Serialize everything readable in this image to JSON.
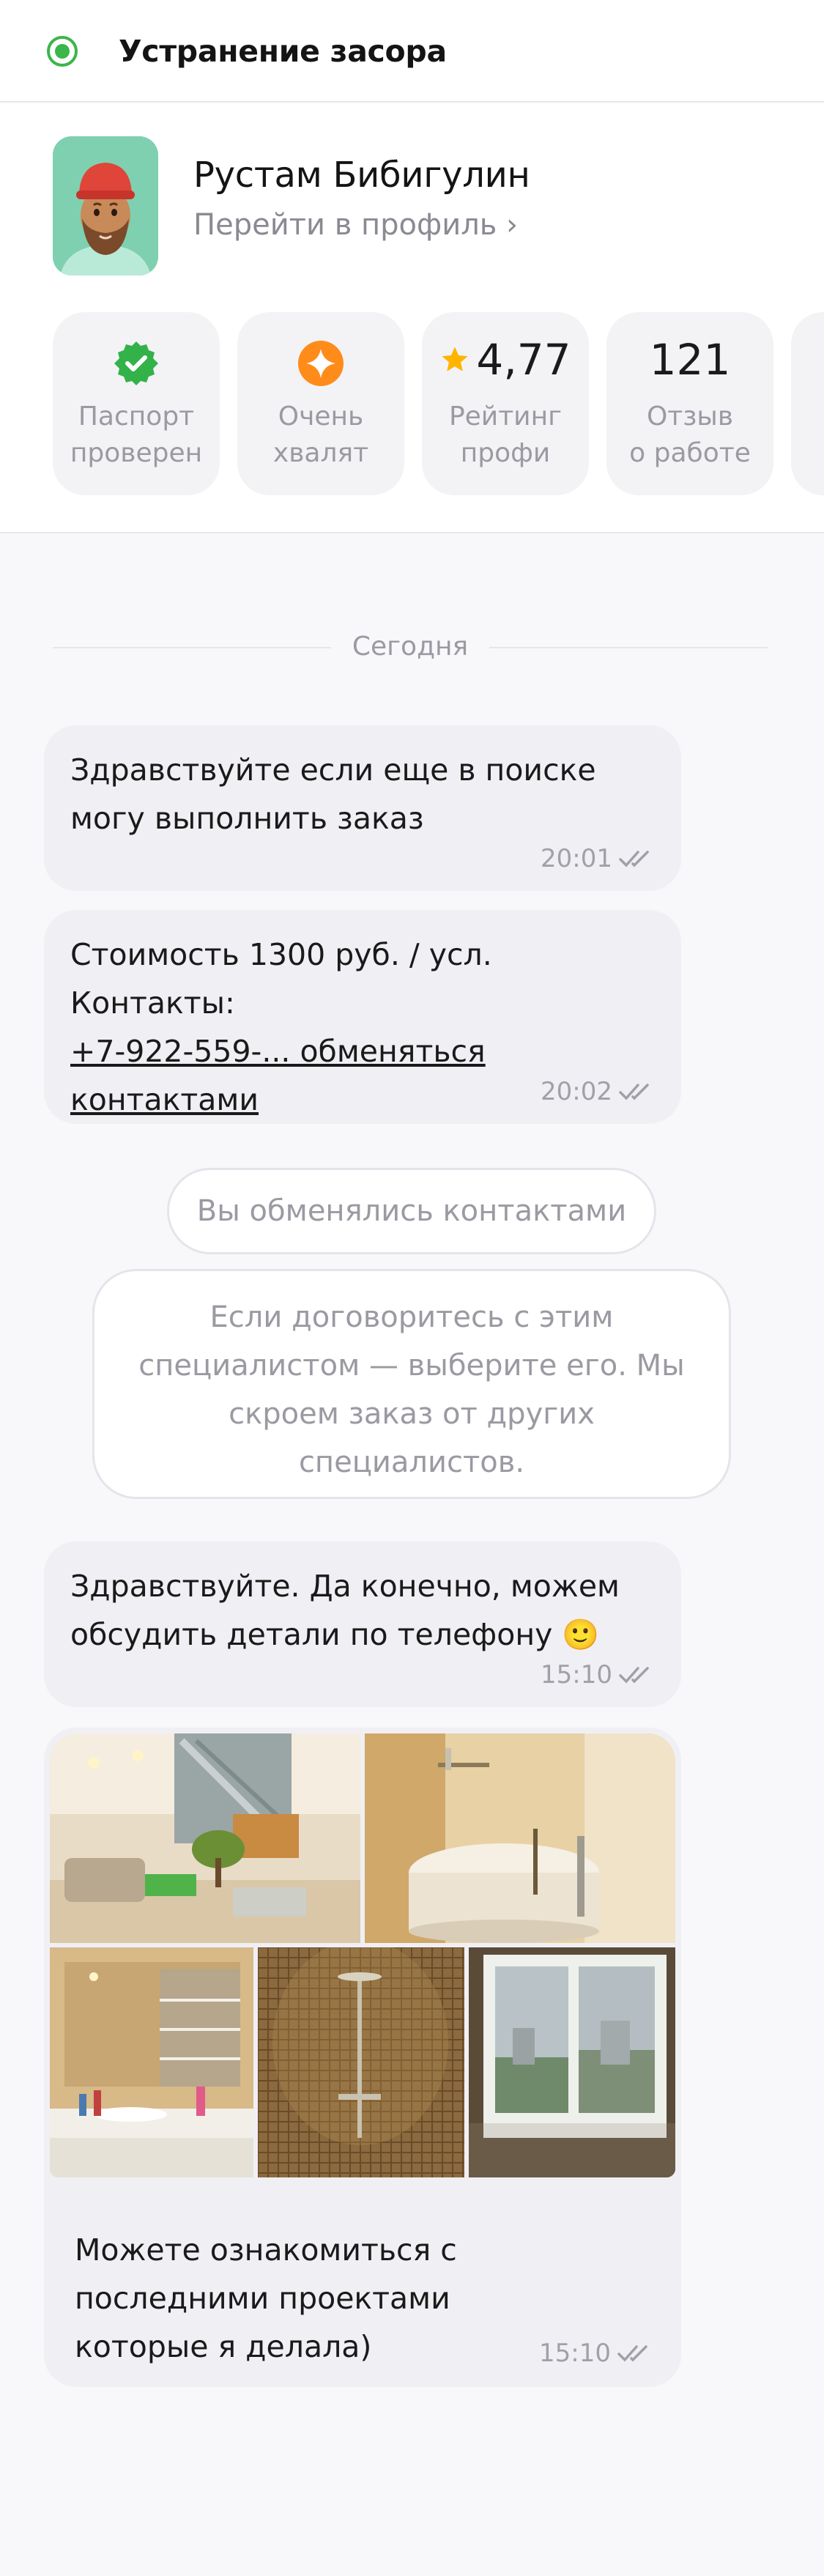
{
  "header": {
    "task_title": "Устранение засора"
  },
  "profile": {
    "name": "Рустам Бибигулин",
    "profile_link": "Перейти в профиль ›",
    "badges": [
      {
        "icon": "verified-check-icon",
        "value": "",
        "line1": "Паспорт",
        "line2": "проверен"
      },
      {
        "icon": "star-sparkle-icon",
        "value": "",
        "line1": "Очень",
        "line2": "хвалят"
      },
      {
        "icon": "star-icon",
        "value": "4,77",
        "line1": "Рейтинг",
        "line2": "профи"
      },
      {
        "icon": "",
        "value": "121",
        "line1": "Отзыв",
        "line2": "о работе"
      }
    ],
    "colors": {
      "verified": "#34b24a",
      "praise": "#ff8c1a",
      "star": "#ffb400"
    }
  },
  "chat": {
    "date_separator": "Сегодня",
    "messages": [
      {
        "lines": [
          "Здравствуйте если еще в поиске",
          "могу выполнить заказ"
        ],
        "time": "20:01"
      },
      {
        "line1": "Стоимость 1300 руб. / усл. Контакты:",
        "line2_link": "+7-922-559-... обменяться",
        "line3_link": "контактами",
        "time": "20:02"
      },
      {
        "lines": [
          "Здравствуйте. Да конечно, можем",
          "обсудить детали по телефону 🙂"
        ],
        "time": "15:10"
      },
      {
        "lines": [
          "Можете ознакомиться с",
          "последними проектами",
          "которые я делала)"
        ],
        "time": "15:10"
      }
    ],
    "system_pill": "Вы обменялись контактами",
    "system_notice": [
      "Если договоритесь с этим",
      "специалистом — выберите его. Мы",
      "скроем заказ от других",
      "специалистов."
    ]
  }
}
